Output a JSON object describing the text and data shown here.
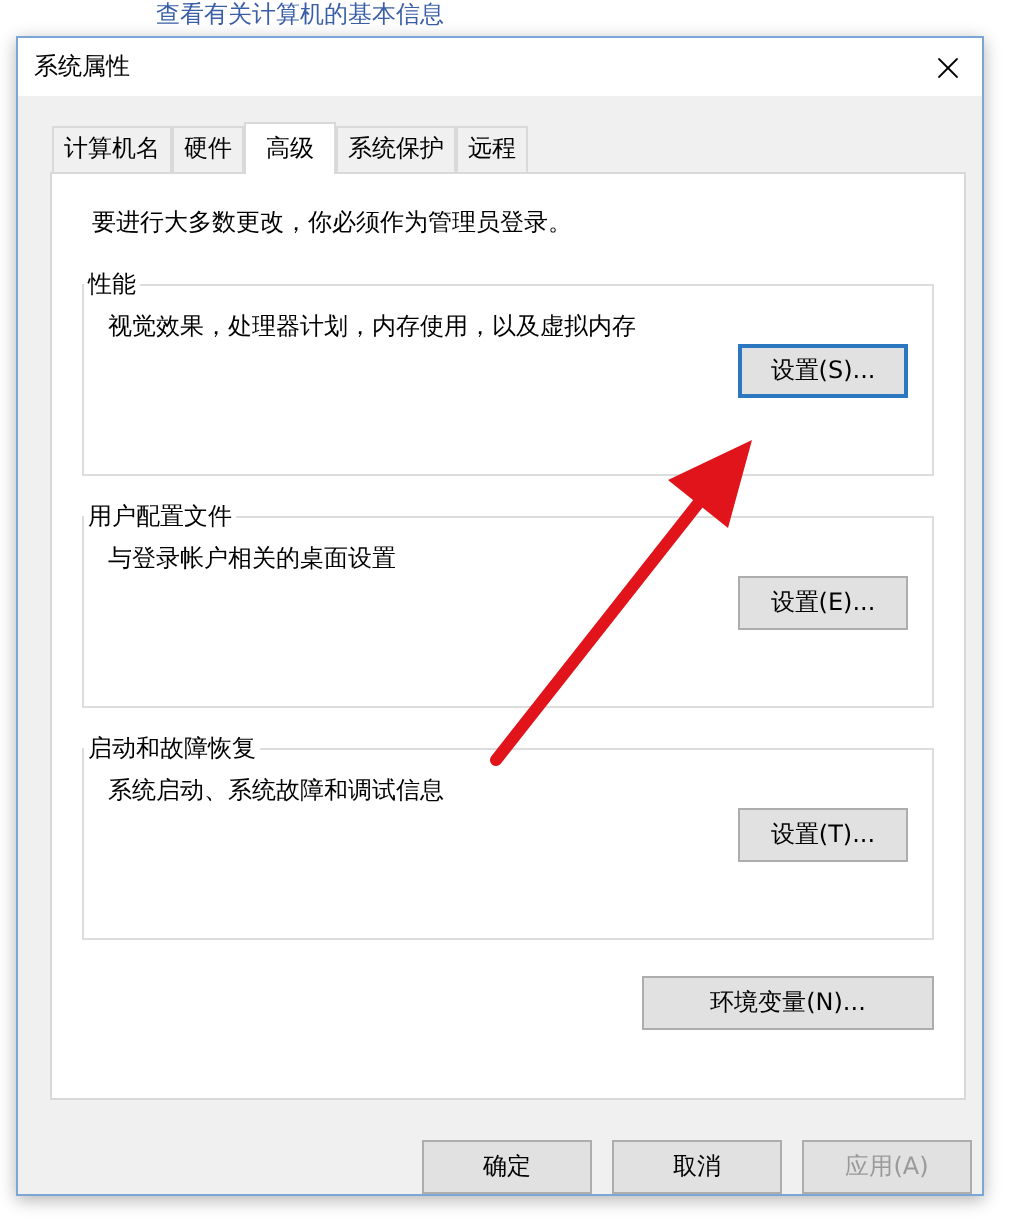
{
  "background": {
    "heading": "查看有关计算机的基本信息"
  },
  "window": {
    "title": "系统属性"
  },
  "tabs": [
    {
      "label": "计算机名",
      "selected": false
    },
    {
      "label": "硬件",
      "selected": false
    },
    {
      "label": "高级",
      "selected": true
    },
    {
      "label": "系统保护",
      "selected": false
    },
    {
      "label": "远程",
      "selected": false
    }
  ],
  "notice": "要进行大多数更改，你必须作为管理员登录。",
  "groups": [
    {
      "title": "性能",
      "description": "视觉效果，处理器计划，内存使用，以及虚拟内存",
      "button": {
        "label": "设置(S)...",
        "focused": true
      }
    },
    {
      "title": "用户配置文件",
      "description": "与登录帐户相关的桌面设置",
      "button": {
        "label": "设置(E)...",
        "focused": false
      }
    },
    {
      "title": "启动和故障恢复",
      "description": "系统启动、系统故障和调试信息",
      "button": {
        "label": "设置(T)...",
        "focused": false
      }
    }
  ],
  "env_button": {
    "label": "环境变量(N)..."
  },
  "buttons": [
    {
      "label": "确定",
      "disabled": false
    },
    {
      "label": "取消",
      "disabled": false
    },
    {
      "label": "应用(A)",
      "disabled": true
    }
  ]
}
